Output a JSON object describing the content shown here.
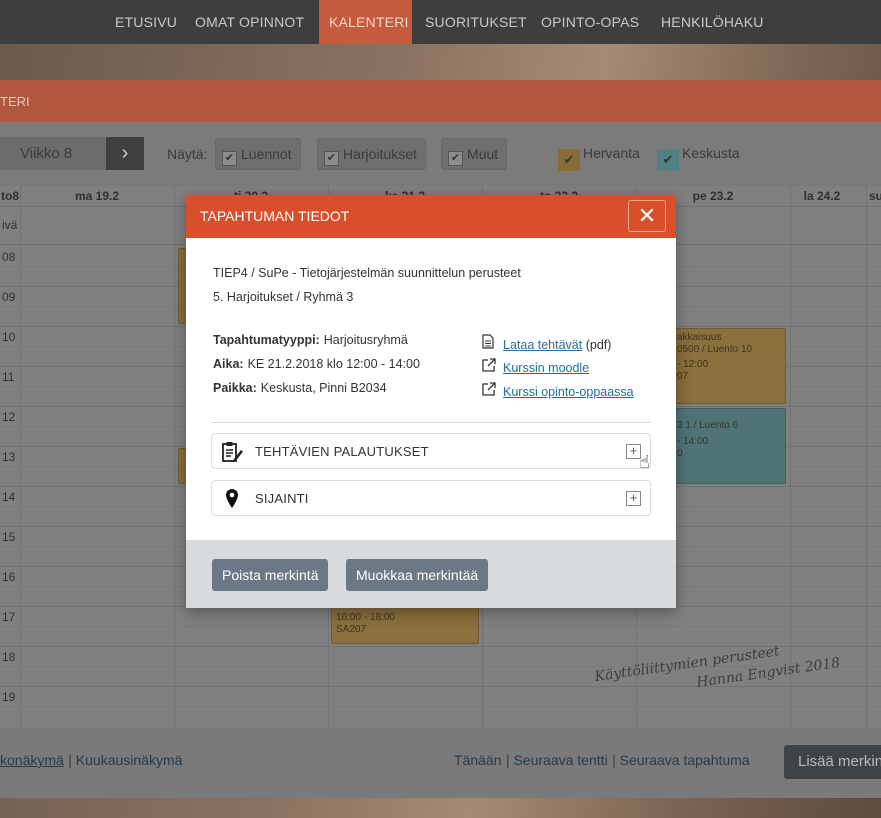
{
  "nav": {
    "items": [
      "ETUSIVU",
      "OMAT OPINNOT",
      "KALENTERI",
      "SUORITUKSET",
      "OPINTO-OPAS",
      "HENKILÖHAKU"
    ],
    "active_index": 2
  },
  "page": {
    "title": "TERI"
  },
  "controls": {
    "week": "Viikko 8",
    "next_icon": "chevron-right-icon",
    "show_label": "Näytä:",
    "filters": [
      "Luennot",
      "Harjoitukset",
      "Muut"
    ],
    "campuses": [
      {
        "label": "Hervanta",
        "color": "#e8a33a"
      },
      {
        "label": "Keskusta",
        "color": "#5cc3c8"
      }
    ]
  },
  "calendar": {
    "headers": [
      "to8",
      "ma 19.2",
      "ti 20.2",
      "ke 21.2",
      "to 22.2",
      "pe 23.2",
      "la 24.2",
      "su"
    ],
    "allday_label": "ivä",
    "hours": [
      "08",
      "09",
      "10",
      "11",
      "12",
      "13",
      "14",
      "15",
      "16",
      "17",
      "18",
      "19"
    ],
    "events": {
      "fri_orange": [
        "akkaisuus",
        "0500 / Luento 10",
        "- 12:00",
        "07"
      ],
      "fri_teal": [
        "3 1 / Luento 6",
        "- 14:00",
        "0"
      ],
      "wed_bottom": [
        "16:00 - 18:00",
        "SA207"
      ]
    }
  },
  "signature": {
    "line1": "Käyttöliittymien perusteet",
    "line2": "Hanna Engvist 2018"
  },
  "footer": {
    "left_links": [
      "konäkymä",
      "Kuukausinäkymä"
    ],
    "right_links": [
      "Tänään",
      "Seuraava tentti",
      "Seuraava tapahtuma"
    ],
    "add_button": "Lisää merkin"
  },
  "modal": {
    "title": "TAPAHTUMAN TIEDOT",
    "course": "TIEP4 / SuPe - Tietojärjestelmän suunnittelun perusteet",
    "group": "5. Harjoitukset / Ryhmä 3",
    "type_label": "Tapahtumatyyppi:",
    "type_value": "Harjoitusryhmä",
    "time_label": "Aika:",
    "time_value": "KE 21.2.2018 klo 12:00 - 14:00",
    "place_label": "Paikka:",
    "place_value": "Keskusta, Pinni B2034",
    "link_tasks": "Lataa tehtävät",
    "link_tasks_suffix": "(pdf)",
    "link_moodle": "Kurssin moodle",
    "link_guide": "Kurssi opinto-oppaassa",
    "accordion_returns": "TEHTÄVIEN PALAUTUKSET",
    "accordion_location": "SIJAINTI",
    "btn_delete": "Poista merkintä",
    "btn_edit": "Muokkaa merkintää"
  }
}
